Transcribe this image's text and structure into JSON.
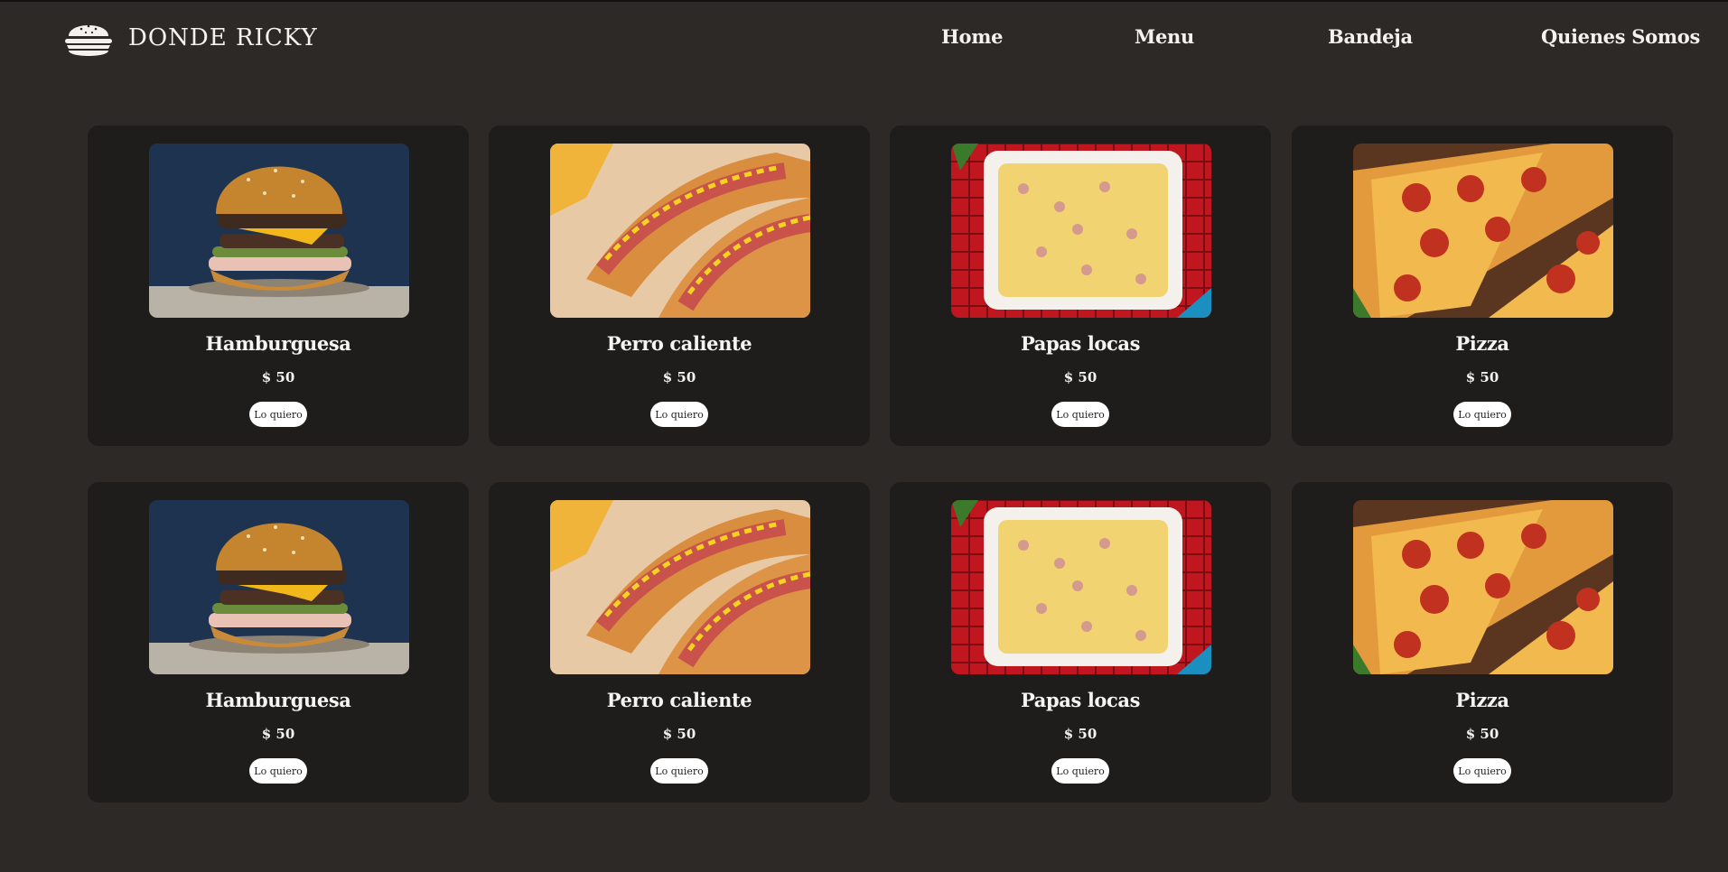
{
  "header": {
    "brand_name": "DONDE RICKY",
    "logo_icon": "burger-logo-icon",
    "nav": [
      {
        "label": "Home"
      },
      {
        "label": "Menu"
      },
      {
        "label": "Bandeja"
      },
      {
        "label": "Quienes Somos"
      }
    ]
  },
  "products": [
    {
      "name": "Hamburguesa",
      "price": "$ 50",
      "button": "Lo quiero",
      "image": "burger-photo"
    },
    {
      "name": "Perro caliente",
      "price": "$ 50",
      "button": "Lo quiero",
      "image": "hotdog-photo"
    },
    {
      "name": "Papas locas",
      "price": "$ 50",
      "button": "Lo quiero",
      "image": "papas-locas-photo"
    },
    {
      "name": "Pizza",
      "price": "$ 50",
      "button": "Lo quiero",
      "image": "pizza-photo"
    },
    {
      "name": "Hamburguesa",
      "price": "$ 50",
      "button": "Lo quiero",
      "image": "burger-photo"
    },
    {
      "name": "Perro caliente",
      "price": "$ 50",
      "button": "Lo quiero",
      "image": "hotdog-photo"
    },
    {
      "name": "Papas locas",
      "price": "$ 50",
      "button": "Lo quiero",
      "image": "papas-locas-photo"
    },
    {
      "name": "Pizza",
      "price": "$ 50",
      "button": "Lo quiero",
      "image": "pizza-photo"
    }
  ],
  "colors": {
    "page_background": "#2c2927",
    "card_background": "#1f1d1c",
    "text": "#f4f2ef",
    "button_background": "#ffffff"
  }
}
